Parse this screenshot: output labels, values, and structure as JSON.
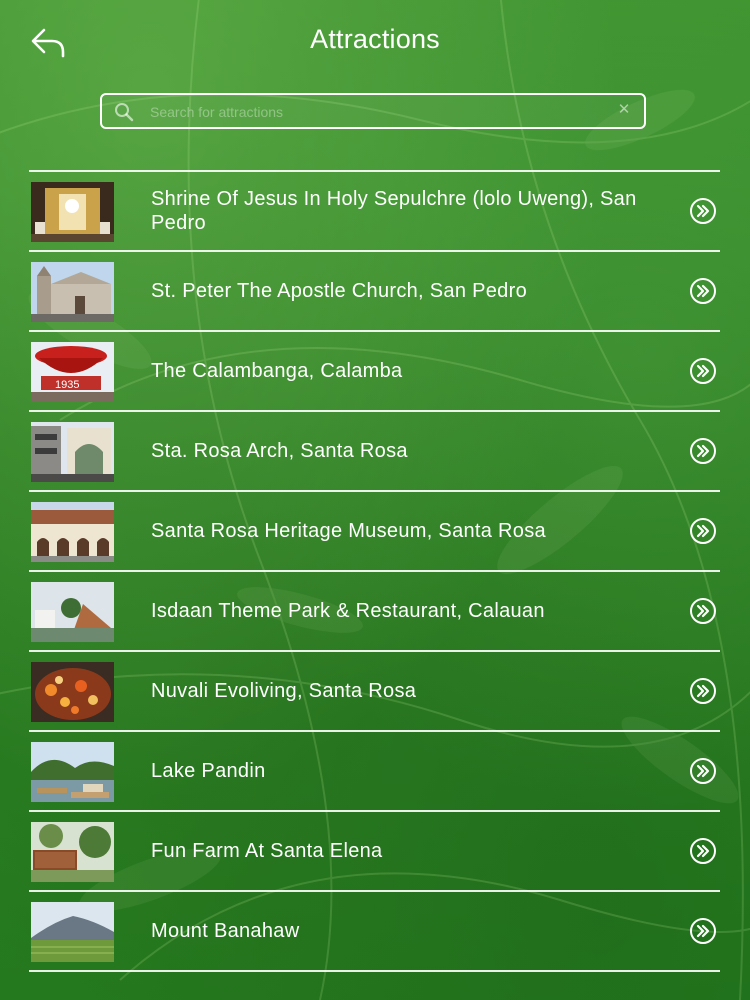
{
  "header": {
    "title": "Attractions"
  },
  "search": {
    "placeholder": "Search for attractions",
    "value": ""
  },
  "icons": {
    "back": "back-arrow-icon",
    "search": "search-icon",
    "clear": "clear-icon",
    "row_action": "double-chevron-right-circle-icon"
  },
  "colors": {
    "background": "#2f8426",
    "text": "#ffffff",
    "divider": "#ffffff"
  },
  "attractions": [
    {
      "label": "Shrine Of Jesus In Holy Sepulchre (lolo Uweng), San Pedro"
    },
    {
      "label": "St. Peter The Apostle Church, San Pedro"
    },
    {
      "label": "The Calambanga, Calamba"
    },
    {
      "label": "Sta. Rosa Arch, Santa Rosa"
    },
    {
      "label": "Santa Rosa Heritage Museum, Santa Rosa"
    },
    {
      "label": "Isdaan Theme Park & Restaurant, Calauan"
    },
    {
      "label": "Nuvali Evoliving, Santa Rosa"
    },
    {
      "label": "Lake Pandin"
    },
    {
      "label": "Fun Farm At Santa Elena"
    },
    {
      "label": "Mount Banahaw"
    }
  ]
}
